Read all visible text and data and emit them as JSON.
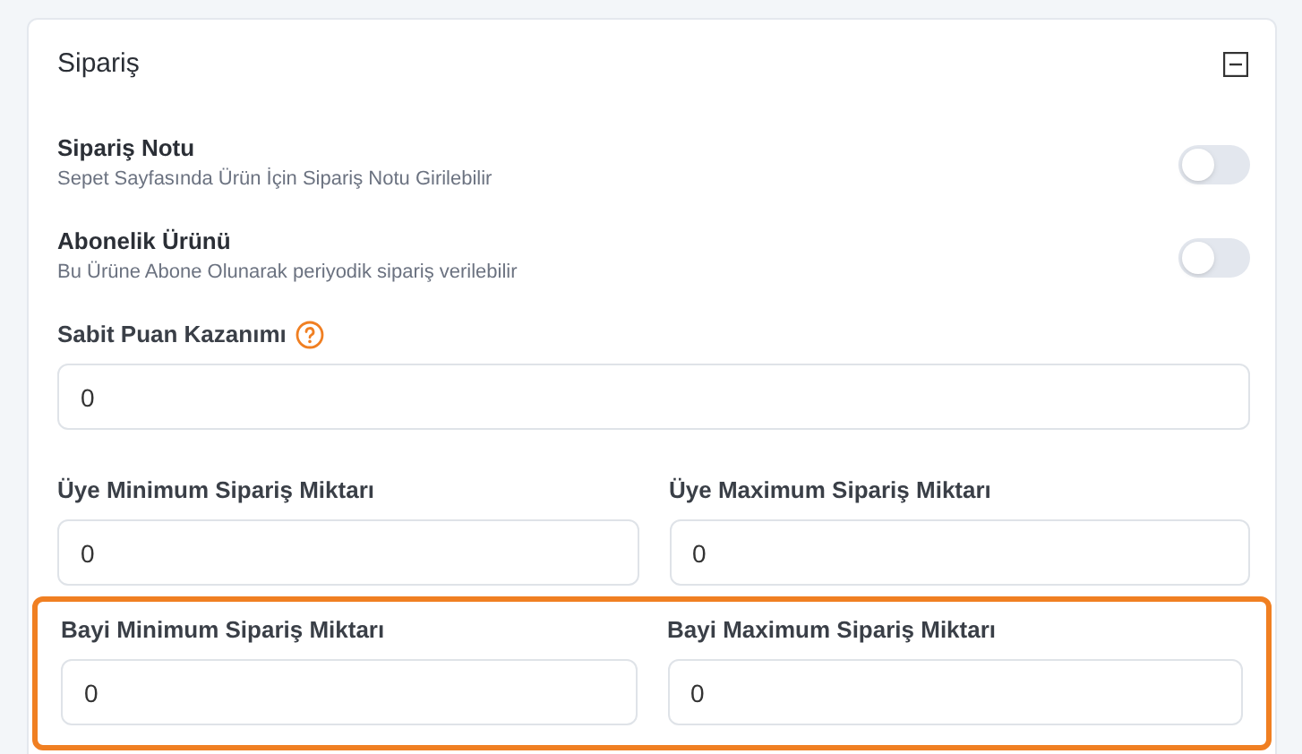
{
  "panel": {
    "title": "Sipariş",
    "expanded": true
  },
  "toggles": [
    {
      "label": "Sipariş Notu",
      "description": "Sepet Sayfasında Ürün İçin Sipariş Notu Girilebilir",
      "on": false
    },
    {
      "label": "Abonelik Ürünü",
      "description": "Bu Ürüne Abone Olunarak periyodik sipariş verilebilir",
      "on": false
    }
  ],
  "rows": [
    {
      "fields": [
        {
          "label": "Sabit Puan Kazanımı",
          "help": true,
          "value": "0"
        }
      ]
    },
    {
      "fields": [
        {
          "label": "Üye Minimum Sipariş Miktarı",
          "value": "0"
        },
        {
          "label": "Üye Maximum Sipariş Miktarı",
          "value": "0"
        }
      ]
    },
    {
      "highlighted": true,
      "fields": [
        {
          "label": "Bayi Minimum Sipariş Miktarı",
          "value": "0"
        },
        {
          "label": "Bayi Maximum Sipariş Miktarı",
          "value": "0"
        }
      ]
    }
  ]
}
